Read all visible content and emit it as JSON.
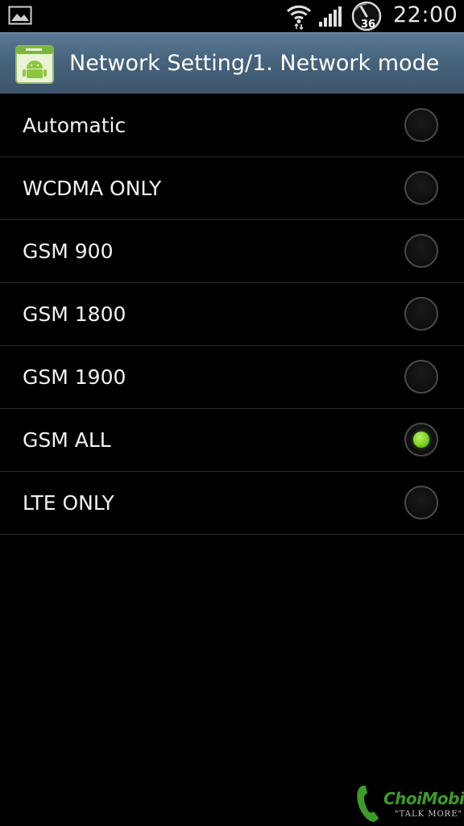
{
  "status_bar": {
    "clock": "22:00",
    "battery_level": "36",
    "icons": [
      "gallery-icon",
      "wifi-icon",
      "signal-icon",
      "battery-gauge-icon"
    ]
  },
  "title_bar": {
    "title": "Network Setting/1. Network mode",
    "icon": "android-app-icon"
  },
  "options": [
    {
      "label": "Automatic",
      "selected": false
    },
    {
      "label": "WCDMA ONLY",
      "selected": false
    },
    {
      "label": "GSM 900",
      "selected": false
    },
    {
      "label": "GSM 1800",
      "selected": false
    },
    {
      "label": "GSM 1900",
      "selected": false
    },
    {
      "label": "GSM ALL",
      "selected": true
    },
    {
      "label": "LTE ONLY",
      "selected": false
    }
  ],
  "colors": {
    "accent_selected": "#7ed321",
    "title_bar": "#46637c",
    "background": "#000000"
  },
  "watermark": {
    "brand": "ChoiMobile",
    "tagline": "\"TALK MORE\""
  }
}
